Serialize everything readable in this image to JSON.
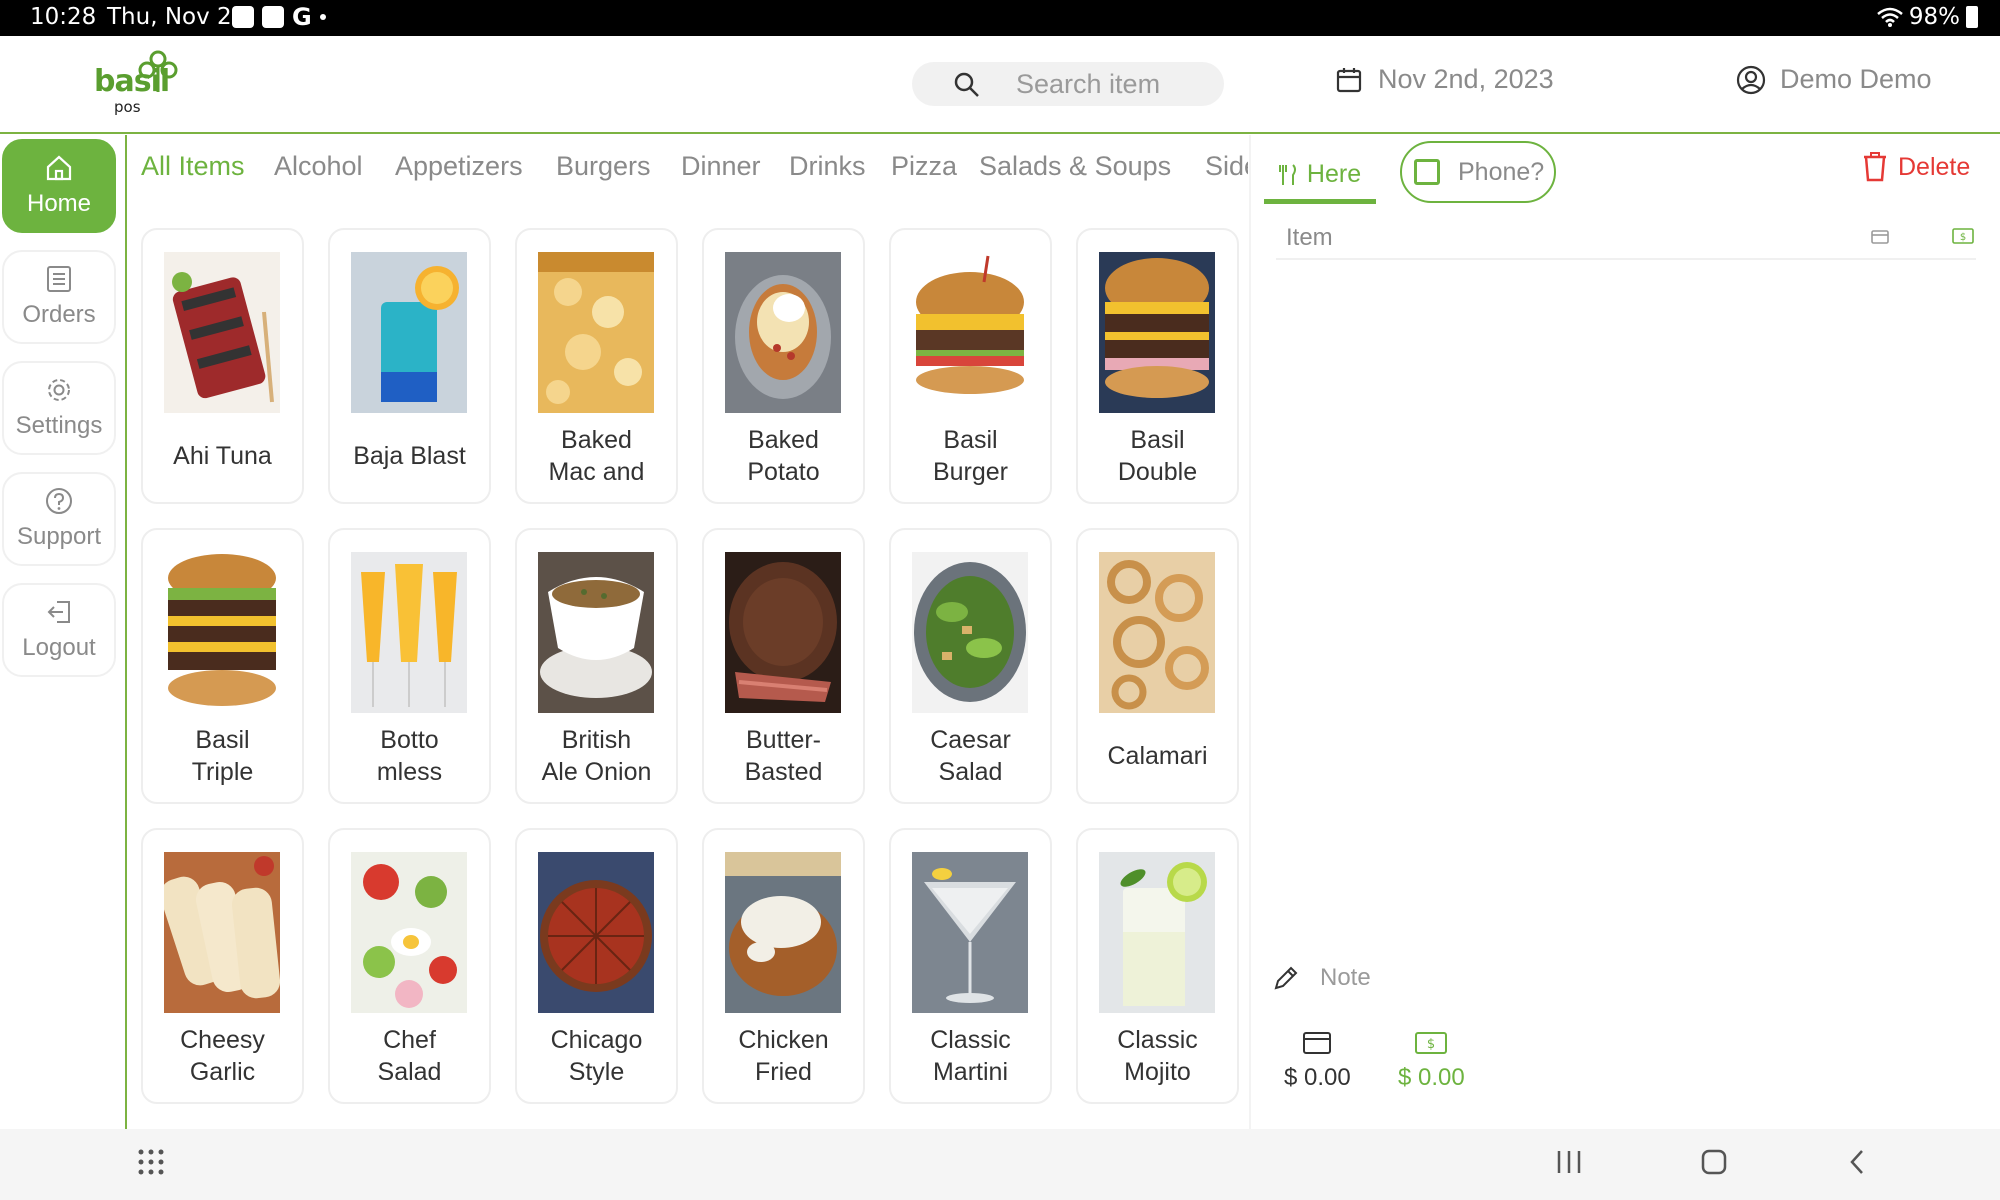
{
  "status_bar": {
    "time": "10:28",
    "date": "Thu, Nov 2",
    "google_letter": "G",
    "battery": "98%"
  },
  "header": {
    "logo_text": "basil",
    "logo_sub": "pos",
    "search_placeholder": "Search item",
    "date": "Nov 2nd, 2023",
    "user_name": "Demo Demo"
  },
  "sidebar": {
    "items": [
      {
        "label": "Home",
        "icon": "home-icon"
      },
      {
        "label": "Orders",
        "icon": "list-icon"
      },
      {
        "label": "Settings",
        "icon": "gear-icon"
      },
      {
        "label": "Support",
        "icon": "help-icon"
      },
      {
        "label": "Logout",
        "icon": "logout-icon"
      }
    ]
  },
  "categories": [
    "All Items",
    "Alcohol",
    "Appetizers",
    "Burgers",
    "Dinner",
    "Drinks",
    "Pizza",
    "Salads & Soups",
    "Side"
  ],
  "menu_items": [
    {
      "name": "Ahi Tuna"
    },
    {
      "name": "Baja Blast"
    },
    {
      "name": "Baked\nMac and"
    },
    {
      "name": "Baked\nPotato"
    },
    {
      "name": "Basil\nBurger"
    },
    {
      "name": "Basil\nDouble"
    },
    {
      "name": "Basil\nTriple"
    },
    {
      "name": "Botto\nmless"
    },
    {
      "name": "British\nAle Onion"
    },
    {
      "name": "Butter-\nBasted"
    },
    {
      "name": "Caesar\nSalad"
    },
    {
      "name": "Calamari"
    },
    {
      "name": "Cheesy\nGarlic"
    },
    {
      "name": "Chef\nSalad"
    },
    {
      "name": "Chicago\nStyle"
    },
    {
      "name": "Chicken\nFried"
    },
    {
      "name": "Classic\nMartini"
    },
    {
      "name": "Classic\nMojito"
    }
  ],
  "order": {
    "here_label": "Here",
    "phone_label": "Phone?",
    "delete_label": "Delete",
    "item_header": "Item",
    "note_label": "Note",
    "card_total": "$ 0.00",
    "cash_total": "$ 0.00"
  },
  "colors": {
    "accent": "#6db33f",
    "danger": "#e53935",
    "muted": "#8a8a8a"
  }
}
